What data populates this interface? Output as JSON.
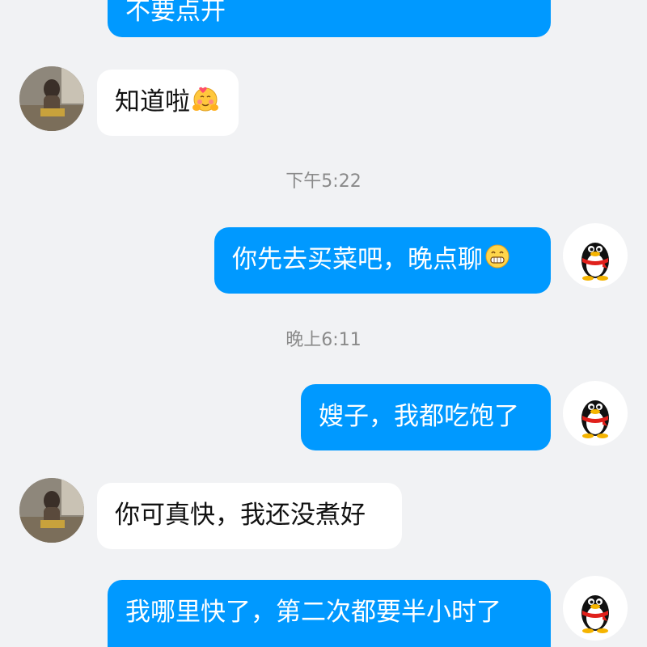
{
  "messages": [
    {
      "text": "不要点开"
    },
    {
      "text": "知道啦"
    },
    {
      "text": "你先去买菜吧，晚点聊"
    },
    {
      "text": "嫂子，我都吃饱了"
    },
    {
      "text": "你可真快，我还没煮好"
    },
    {
      "text": "我哪里快了，第二次都要半小时了"
    }
  ],
  "timestamps": [
    "下午5:22",
    "晚上6:11"
  ],
  "colors": {
    "background": "#f1f2f4",
    "outgoing_bubble": "#0099ff",
    "incoming_bubble": "#ffffff",
    "timestamp_text": "#8a8a8a"
  },
  "icons": {
    "user_avatar": "qq-penguin-icon",
    "emoji_blush": "blush-hands-emoji-icon",
    "emoji_grin": "grin-emoji-icon"
  }
}
